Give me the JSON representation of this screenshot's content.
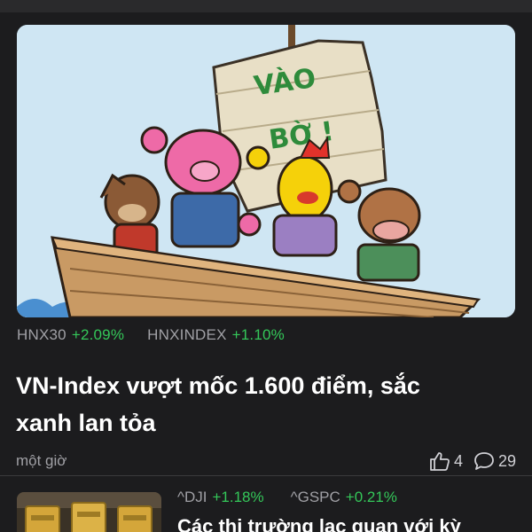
{
  "articles": [
    {
      "image_text": [
        "VÀO",
        "BỜ !"
      ],
      "tickers": [
        {
          "symbol": "HNX30",
          "change": "+2.09%"
        },
        {
          "symbol": "HNXINDEX",
          "change": "+1.10%"
        }
      ],
      "title_lines": [
        "VN-Index vượt mốc 1.600 điểm, sắc",
        "xanh lan tỏa"
      ],
      "time": "một giờ",
      "likes": "4",
      "comments": "29"
    },
    {
      "tickers": [
        {
          "symbol": "^DJI",
          "change": "+1.18%"
        },
        {
          "symbol": "^GSPC",
          "change": "+0.21%"
        }
      ],
      "title": "Các thị trường lạc quan với kỳ"
    }
  ],
  "colors": {
    "positive": "#34c759",
    "background": "#1c1c1e",
    "muted": "#a0a0a5"
  }
}
